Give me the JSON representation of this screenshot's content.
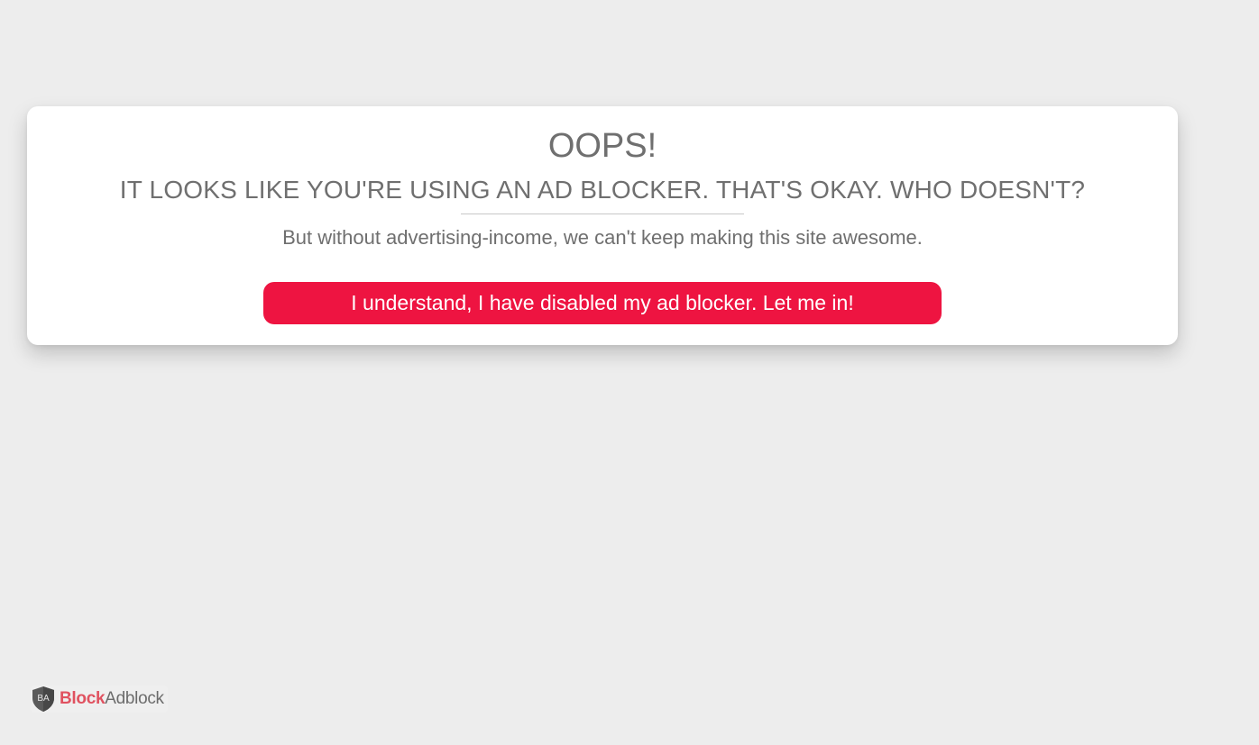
{
  "modal": {
    "title": "OOPS!",
    "subtitle": "IT LOOKS LIKE YOU'RE USING AN AD BLOCKER. THAT'S OKAY. WHO DOESN'T?",
    "message": "But without advertising-income, we can't keep making this site awesome.",
    "button_label": "I understand, I have disabled my ad blocker. Let me in!"
  },
  "branding": {
    "logo_icon": "shield-icon",
    "logo_initials": "BA",
    "name_part1": "Block",
    "name_part2": "Adblock"
  },
  "colors": {
    "background": "#ededed",
    "card": "#ffffff",
    "text": "#6f6f6f",
    "button": "#ee1441",
    "button_text": "#ffffff",
    "brand_accent": "#e05260"
  }
}
